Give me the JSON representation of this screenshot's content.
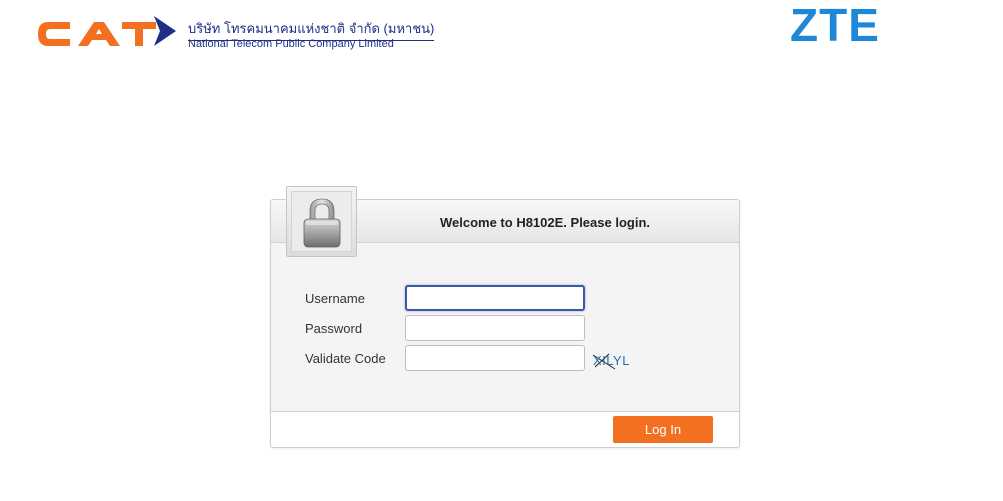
{
  "header": {
    "cat_logo_text": "CAT",
    "cat_thai_name": "บริษัท โทรคมนาคมแห่งชาติ จำกัด (มหาชน)",
    "cat_english_name": "National Telecom Public Company Limited",
    "zte_logo_text": "ZTE"
  },
  "login": {
    "title": "Welcome to H8102E. Please login.",
    "lock_icon": "padlock-icon",
    "fields": {
      "username_label": "Username",
      "username_value": "",
      "password_label": "Password",
      "password_value": "",
      "validate_label": "Validate Code",
      "validate_value": ""
    },
    "captcha_text": "XILYL",
    "login_button": "Log In"
  },
  "colors": {
    "cat_orange": "#f37021",
    "cat_navy": "#1f2f86",
    "zte_blue": "#1e88d8",
    "login_button": "#f37021",
    "focus_border": "#3a5aa8"
  }
}
